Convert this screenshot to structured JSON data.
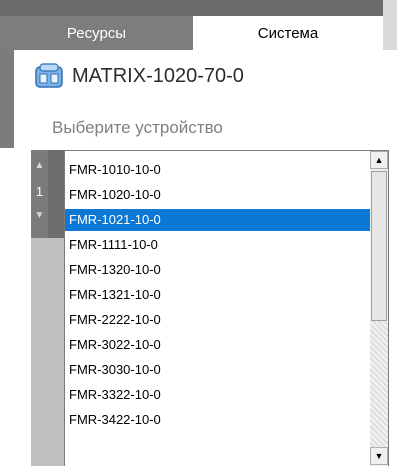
{
  "tabs": [
    {
      "label": "Ресурсы",
      "active": false
    },
    {
      "label": "Система",
      "active": true
    }
  ],
  "device": {
    "icon": "server-icon",
    "name": "MATRIX-1020-70-0"
  },
  "prompt": "Выберите устройство",
  "pager": {
    "up_icon": "arrow-up-icon",
    "page": "1",
    "down_icon": "arrow-down-icon"
  },
  "list": {
    "items": [
      "FMR-1010-10-0",
      "FMR-1020-10-0",
      "FMR-1021-10-0",
      "FMR-1111-10-0",
      "FMR-1320-10-0",
      "FMR-1321-10-0",
      "FMR-2222-10-0",
      "FMR-3022-10-0",
      "FMR-3030-10-0",
      "FMR-3322-10-0",
      "FMR-3422-10-0"
    ],
    "selected_index": 2
  },
  "colors": {
    "selection": "#0a78d4",
    "tab_inactive_bg": "#7d7d7d"
  }
}
